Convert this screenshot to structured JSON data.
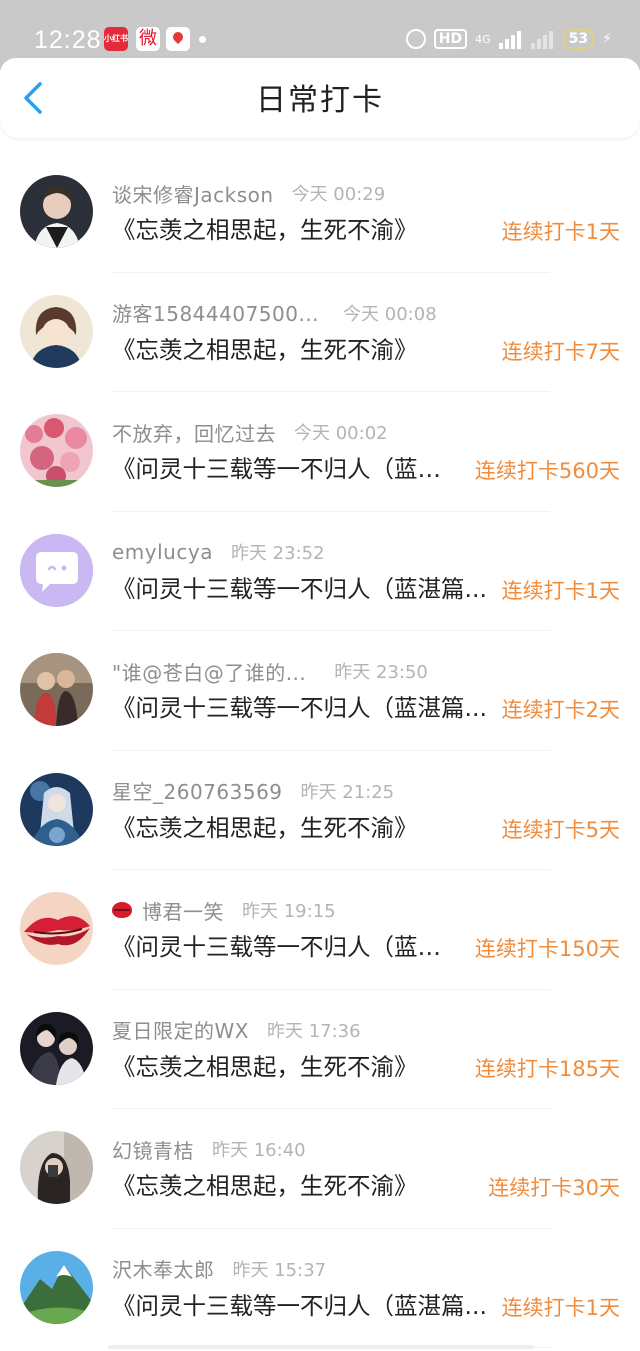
{
  "status_bar": {
    "time": "12:28",
    "app_icons": [
      {
        "name": "xiaohongshu-icon",
        "label": "小红书"
      },
      {
        "name": "weibo-icon",
        "label": "微"
      },
      {
        "name": "map-icon",
        "label": ""
      }
    ],
    "hd_label": "HD",
    "network_label": "4G",
    "battery": "53",
    "colors": {
      "background": "#c9c9c9",
      "battery": "#e2d27c"
    }
  },
  "header": {
    "title": "日常打卡",
    "back_icon": "chevron-left-icon",
    "colors": {
      "back": "#2a9ef5"
    }
  },
  "colors": {
    "streak": "#f08c3c",
    "name": "#8e8e8e",
    "time": "#b4b4b4",
    "title": "#222222"
  },
  "items": [
    {
      "name": "谈宋修睿Jackson",
      "time": "今天 00:29",
      "title": "《忘羡之相思起，生死不渝》",
      "streak": "连续打卡1天"
    },
    {
      "name": "游客15844407500...",
      "time": "今天 00:08",
      "title": "《忘羡之相思起，生死不渝》",
      "streak": "连续打卡7天"
    },
    {
      "name": "不放弃，回忆过去",
      "time": "今天 00:02",
      "title": "《问灵十三载等一不归人（蓝湛...",
      "streak": "连续打卡560天"
    },
    {
      "name": "emylucya",
      "time": "昨天 23:52",
      "title": "《问灵十三载等一不归人（蓝湛篇...",
      "streak": "连续打卡1天"
    },
    {
      "name": "\"谁@苍白@了谁的...",
      "time": "昨天 23:50",
      "title": "《问灵十三载等一不归人（蓝湛篇...",
      "streak": "连续打卡2天"
    },
    {
      "name": "星空_260763569",
      "time": "昨天 21:25",
      "title": "《忘羡之相思起，生死不渝》",
      "streak": "连续打卡5天"
    },
    {
      "name": "博君一笑",
      "time": "昨天 19:15",
      "title": "《问灵十三载等一不归人（蓝湛...",
      "streak": "连续打卡150天",
      "badge": "lips-icon"
    },
    {
      "name": "夏日限定的WX",
      "time": "昨天 17:36",
      "title": "《忘羡之相思起，生死不渝》",
      "streak": "连续打卡185天"
    },
    {
      "name": "幻镜青桔",
      "time": "昨天 16:40",
      "title": "《忘羡之相思起，生死不渝》",
      "streak": "连续打卡30天"
    },
    {
      "name": "沢木奉太郎",
      "time": "昨天 15:37",
      "title": "《问灵十三载等一不归人（蓝湛篇...",
      "streak": "连续打卡1天"
    }
  ]
}
